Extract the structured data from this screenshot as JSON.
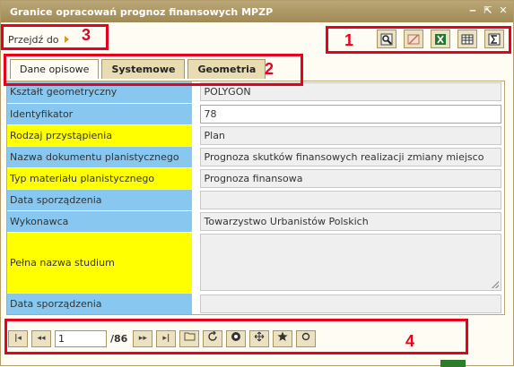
{
  "window": {
    "title": "Granice opracowań prognoz finansowych MPZP",
    "controls": [
      "‒",
      "⇱",
      "✕"
    ]
  },
  "goto": {
    "label": "Przejdź do"
  },
  "toolbar": {
    "buttons": [
      {
        "icon": "search-icon",
        "color": "#303030"
      },
      {
        "icon": "disabled-icon",
        "color": "#c07050"
      },
      {
        "icon": "excel-icon",
        "color": "#1d7a2f"
      },
      {
        "icon": "table-icon",
        "color": "#333"
      },
      {
        "icon": "sigma-icon",
        "color": "#333"
      }
    ]
  },
  "tabs": [
    "Dane opisowe",
    "Systemowe",
    "Geometria"
  ],
  "rows": [
    {
      "label": "Kształt geometryczny",
      "value": "POLYGON",
      "color": "#88c8f0"
    },
    {
      "label": "Identyfikator",
      "value": "78",
      "color": "#88c8f0"
    },
    {
      "label": "Rodzaj przystąpienia",
      "value": "Plan",
      "color": "#ffff00"
    },
    {
      "label": "Nazwa dokumentu planistycznego",
      "value": "Prognoza skutków finansowych realizacji zmiany miejsco",
      "color": "#88c8f0"
    },
    {
      "label": "Typ materiału planistycznego",
      "value": "Prognoza finansowa",
      "color": "#ffff00"
    },
    {
      "label": "Data sporządzenia",
      "value": "",
      "color": "#88c8f0"
    },
    {
      "label": "Wykonawca",
      "value": "Towarzystwo Urbanistów Polskich",
      "color": "#88c8f0"
    },
    {
      "label": "Pełna nazwa studium",
      "value": "",
      "color": "#ffff00"
    },
    {
      "label": "Data sporządzenia",
      "value": "",
      "color": "#88c8f0"
    }
  ],
  "pager": {
    "current": "1",
    "total": "/86"
  },
  "annotations": [
    "1",
    "2",
    "3",
    "4"
  ],
  "colors": {
    "annotation": "#e8001c",
    "title_bar": "#a08a55"
  }
}
